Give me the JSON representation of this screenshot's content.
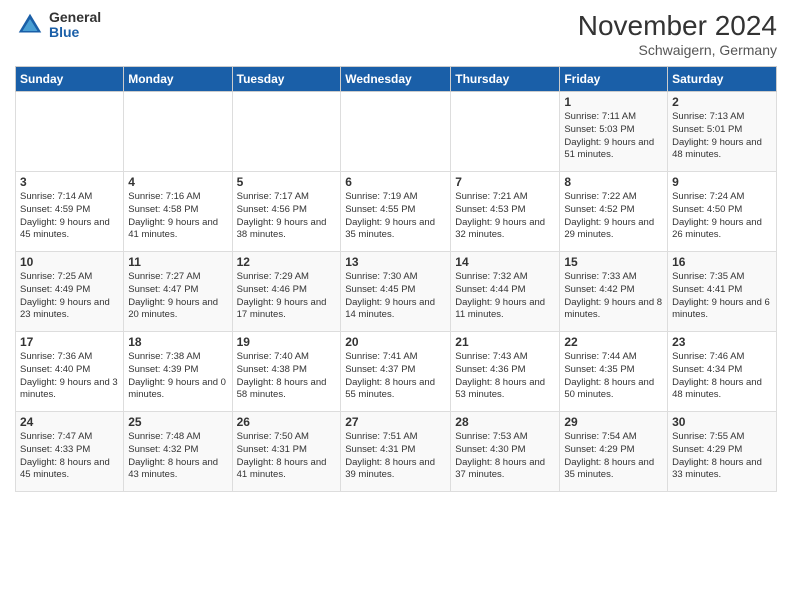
{
  "logo": {
    "general": "General",
    "blue": "Blue"
  },
  "title": "November 2024",
  "subtitle": "Schwaigern, Germany",
  "weekdays": [
    "Sunday",
    "Monday",
    "Tuesday",
    "Wednesday",
    "Thursday",
    "Friday",
    "Saturday"
  ],
  "weeks": [
    [
      {
        "day": "",
        "info": ""
      },
      {
        "day": "",
        "info": ""
      },
      {
        "day": "",
        "info": ""
      },
      {
        "day": "",
        "info": ""
      },
      {
        "day": "",
        "info": ""
      },
      {
        "day": "1",
        "info": "Sunrise: 7:11 AM\nSunset: 5:03 PM\nDaylight: 9 hours and 51 minutes."
      },
      {
        "day": "2",
        "info": "Sunrise: 7:13 AM\nSunset: 5:01 PM\nDaylight: 9 hours and 48 minutes."
      }
    ],
    [
      {
        "day": "3",
        "info": "Sunrise: 7:14 AM\nSunset: 4:59 PM\nDaylight: 9 hours and 45 minutes."
      },
      {
        "day": "4",
        "info": "Sunrise: 7:16 AM\nSunset: 4:58 PM\nDaylight: 9 hours and 41 minutes."
      },
      {
        "day": "5",
        "info": "Sunrise: 7:17 AM\nSunset: 4:56 PM\nDaylight: 9 hours and 38 minutes."
      },
      {
        "day": "6",
        "info": "Sunrise: 7:19 AM\nSunset: 4:55 PM\nDaylight: 9 hours and 35 minutes."
      },
      {
        "day": "7",
        "info": "Sunrise: 7:21 AM\nSunset: 4:53 PM\nDaylight: 9 hours and 32 minutes."
      },
      {
        "day": "8",
        "info": "Sunrise: 7:22 AM\nSunset: 4:52 PM\nDaylight: 9 hours and 29 minutes."
      },
      {
        "day": "9",
        "info": "Sunrise: 7:24 AM\nSunset: 4:50 PM\nDaylight: 9 hours and 26 minutes."
      }
    ],
    [
      {
        "day": "10",
        "info": "Sunrise: 7:25 AM\nSunset: 4:49 PM\nDaylight: 9 hours and 23 minutes."
      },
      {
        "day": "11",
        "info": "Sunrise: 7:27 AM\nSunset: 4:47 PM\nDaylight: 9 hours and 20 minutes."
      },
      {
        "day": "12",
        "info": "Sunrise: 7:29 AM\nSunset: 4:46 PM\nDaylight: 9 hours and 17 minutes."
      },
      {
        "day": "13",
        "info": "Sunrise: 7:30 AM\nSunset: 4:45 PM\nDaylight: 9 hours and 14 minutes."
      },
      {
        "day": "14",
        "info": "Sunrise: 7:32 AM\nSunset: 4:44 PM\nDaylight: 9 hours and 11 minutes."
      },
      {
        "day": "15",
        "info": "Sunrise: 7:33 AM\nSunset: 4:42 PM\nDaylight: 9 hours and 8 minutes."
      },
      {
        "day": "16",
        "info": "Sunrise: 7:35 AM\nSunset: 4:41 PM\nDaylight: 9 hours and 6 minutes."
      }
    ],
    [
      {
        "day": "17",
        "info": "Sunrise: 7:36 AM\nSunset: 4:40 PM\nDaylight: 9 hours and 3 minutes."
      },
      {
        "day": "18",
        "info": "Sunrise: 7:38 AM\nSunset: 4:39 PM\nDaylight: 9 hours and 0 minutes."
      },
      {
        "day": "19",
        "info": "Sunrise: 7:40 AM\nSunset: 4:38 PM\nDaylight: 8 hours and 58 minutes."
      },
      {
        "day": "20",
        "info": "Sunrise: 7:41 AM\nSunset: 4:37 PM\nDaylight: 8 hours and 55 minutes."
      },
      {
        "day": "21",
        "info": "Sunrise: 7:43 AM\nSunset: 4:36 PM\nDaylight: 8 hours and 53 minutes."
      },
      {
        "day": "22",
        "info": "Sunrise: 7:44 AM\nSunset: 4:35 PM\nDaylight: 8 hours and 50 minutes."
      },
      {
        "day": "23",
        "info": "Sunrise: 7:46 AM\nSunset: 4:34 PM\nDaylight: 8 hours and 48 minutes."
      }
    ],
    [
      {
        "day": "24",
        "info": "Sunrise: 7:47 AM\nSunset: 4:33 PM\nDaylight: 8 hours and 45 minutes."
      },
      {
        "day": "25",
        "info": "Sunrise: 7:48 AM\nSunset: 4:32 PM\nDaylight: 8 hours and 43 minutes."
      },
      {
        "day": "26",
        "info": "Sunrise: 7:50 AM\nSunset: 4:31 PM\nDaylight: 8 hours and 41 minutes."
      },
      {
        "day": "27",
        "info": "Sunrise: 7:51 AM\nSunset: 4:31 PM\nDaylight: 8 hours and 39 minutes."
      },
      {
        "day": "28",
        "info": "Sunrise: 7:53 AM\nSunset: 4:30 PM\nDaylight: 8 hours and 37 minutes."
      },
      {
        "day": "29",
        "info": "Sunrise: 7:54 AM\nSunset: 4:29 PM\nDaylight: 8 hours and 35 minutes."
      },
      {
        "day": "30",
        "info": "Sunrise: 7:55 AM\nSunset: 4:29 PM\nDaylight: 8 hours and 33 minutes."
      }
    ]
  ]
}
